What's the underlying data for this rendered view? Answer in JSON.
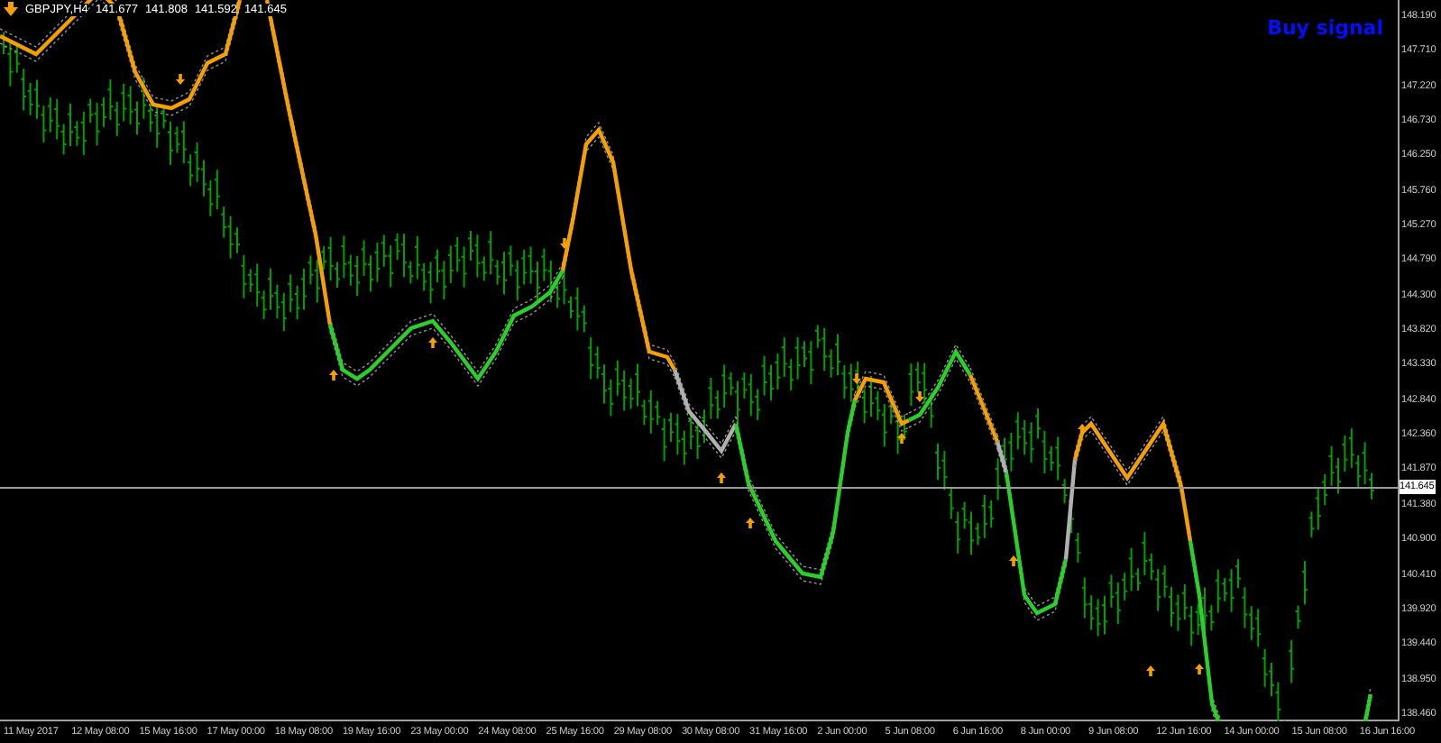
{
  "header": {
    "symbol": "GBPJPY,H4",
    "prices": [
      "141.677",
      "141.808",
      "141.592",
      "141.645"
    ]
  },
  "signal": {
    "text": "Buy signal"
  },
  "price_axis": {
    "ticks": [
      "148.190",
      "147.710",
      "147.220",
      "146.730",
      "146.250",
      "145.760",
      "145.270",
      "144.790",
      "144.300",
      "143.820",
      "143.330",
      "142.840",
      "142.360",
      "141.870",
      "141.380",
      "140.900",
      "140.410",
      "139.920",
      "139.440",
      "138.950",
      "138.460"
    ],
    "current": "141.645"
  },
  "time_axis": {
    "ticks": [
      "11 May 2017",
      "12 May 08:00",
      "15 May 16:00",
      "17 May 00:00",
      "18 May 08:00",
      "19 May 16:00",
      "23 May 00:00",
      "24 May 08:00",
      "25 May 16:00",
      "29 May 08:00",
      "30 May 08:00",
      "31 May 16:00",
      "2 Jun 00:00",
      "5 Jun 08:00",
      "6 Jun 16:00",
      "8 Jun 00:00",
      "9 Jun 08:00",
      "12 Jun 16:00",
      "14 Jun 00:00",
      "15 Jun 08:00",
      "16 Jun 16:00"
    ]
  }
}
